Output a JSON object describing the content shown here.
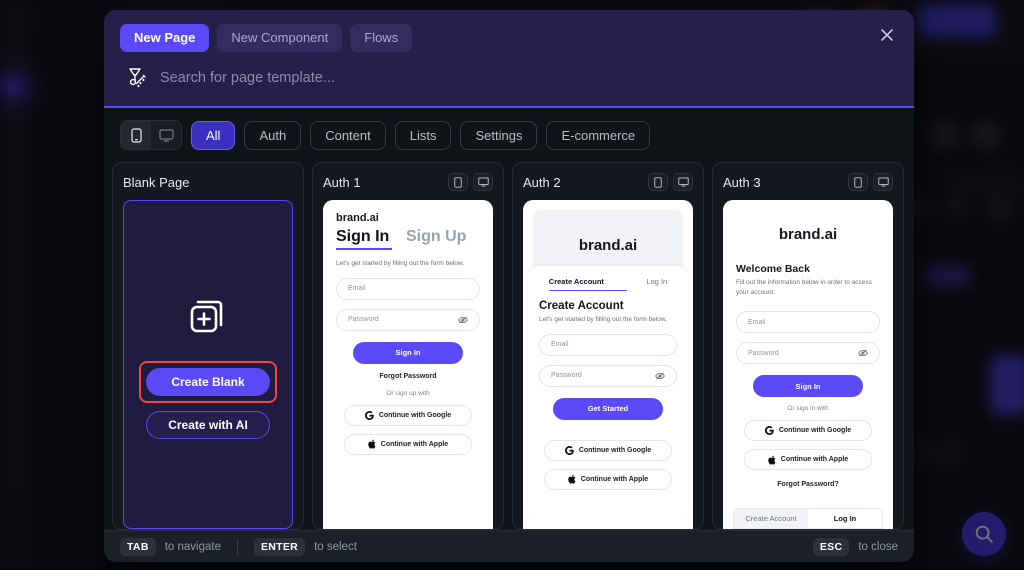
{
  "modal": {
    "mode_tabs": [
      {
        "label": "New Page",
        "active": true
      },
      {
        "label": "New Component",
        "active": false
      },
      {
        "label": "Flows",
        "active": false
      }
    ],
    "close_label": "✕",
    "search": {
      "placeholder": "Search for page template...",
      "value": "",
      "icon": "magic-wand-icon"
    },
    "filters": {
      "devices": [
        {
          "name": "mobile",
          "active": true
        },
        {
          "name": "desktop",
          "active": false
        }
      ],
      "chips": [
        {
          "label": "All",
          "active": true
        },
        {
          "label": "Auth",
          "active": false
        },
        {
          "label": "Content",
          "active": false
        },
        {
          "label": "Lists",
          "active": false
        },
        {
          "label": "Settings",
          "active": false
        },
        {
          "label": "E-commerce",
          "active": false
        }
      ]
    },
    "footer": {
      "tab_key": "TAB",
      "tab_hint": "to navigate",
      "enter_key": "ENTER",
      "enter_hint": "to select",
      "esc_key": "ESC",
      "esc_hint": "to close"
    }
  },
  "cards": {
    "blank": {
      "title": "Blank Page",
      "icon": "add-pages-icon",
      "create_blank_label": "Create Blank",
      "create_ai_label": "Create with AI",
      "selected_button": "create-blank-button",
      "selection_color": "#f0463c"
    },
    "auth1": {
      "title": "Auth 1",
      "brand": "brand.ai",
      "tab_signin": "Sign In",
      "tab_signup": "Sign Up",
      "subtitle": "Let's get started by filling out the form below.",
      "email_placeholder": "Email",
      "password_placeholder": "Password",
      "primary_button": "Sign In",
      "forgot_link": "Forgot Password",
      "or_text": "Or sign up with",
      "google_button": "Continue with Google",
      "apple_button": "Continue with Apple"
    },
    "auth2": {
      "title": "Auth 2",
      "brand": "brand.ai",
      "tab_create": "Create Account",
      "tab_login": "Log In",
      "heading": "Create Account",
      "subtitle": "Let's get started by filling out the form below.",
      "email_placeholder": "Email",
      "password_placeholder": "Password",
      "primary_button": "Get Started",
      "google_button": "Continue with Google",
      "apple_button": "Continue with Apple"
    },
    "auth3": {
      "title": "Auth 3",
      "brand": "brand.ai",
      "heading": "Welcome Back",
      "subtitle": "Fill out the information below in order to access your account.",
      "email_placeholder": "Email",
      "password_placeholder": "Password",
      "primary_button": "Sign In",
      "or_text": "Or sign in with",
      "google_button": "Continue with Google",
      "apple_button": "Continue with Apple",
      "forgot_link": "Forgot Password?",
      "bottom_tab_create": "Create Account",
      "bottom_tab_login": "Log In"
    }
  },
  "backdrop": {
    "search_fab": "search-icon"
  },
  "colors": {
    "accent": "#5b49f5",
    "header_bg": "#242049",
    "modal_bg": "#101318",
    "selection": "#f0463c"
  }
}
